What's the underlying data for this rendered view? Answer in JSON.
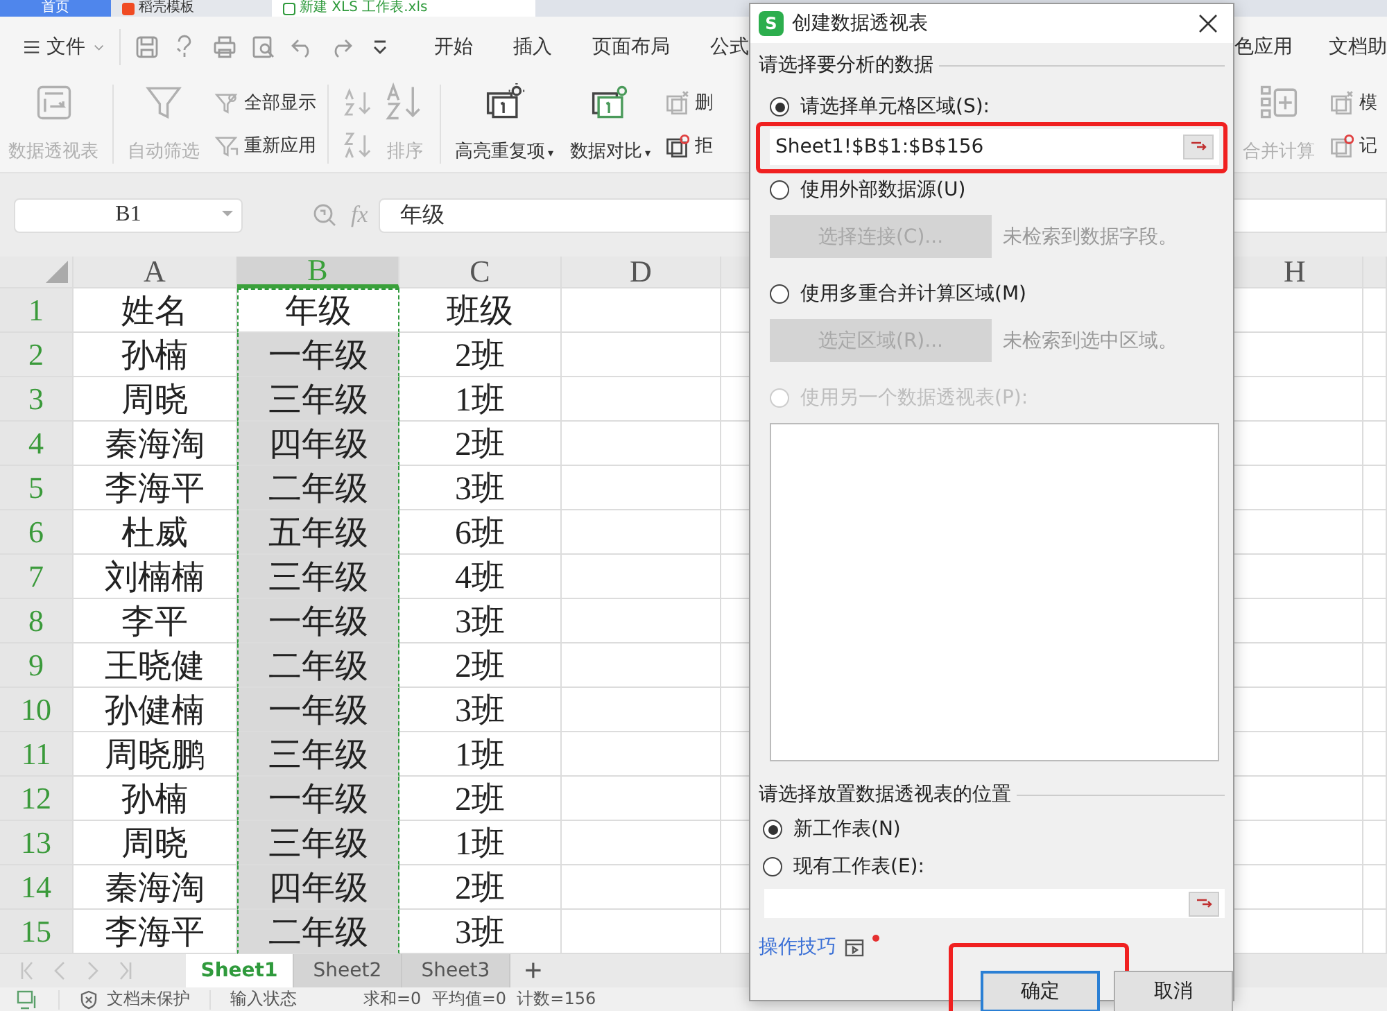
{
  "tabs": [
    {
      "kind": "home",
      "label": "首页",
      "selected": false
    },
    {
      "kind": "template",
      "label": "稻壳模板",
      "selected": false
    },
    {
      "kind": "doc",
      "label": "新建 XLS 工作表.xls",
      "selected": true
    }
  ],
  "menu": {
    "file": "文件",
    "tabs": [
      "开始",
      "插入",
      "页面布局",
      "公式"
    ],
    "tabs_right": [
      "色应用",
      "文档助"
    ]
  },
  "ribbon": [
    {
      "kind": "pivot",
      "label": "数据透视表",
      "disabled": true
    },
    {
      "kind": "filter",
      "label": "自动筛选",
      "disabled": true
    },
    {
      "kind": "filter-pair",
      "items": [
        {
          "label": "全部显示",
          "disabled": true
        },
        {
          "label": "重新应用",
          "disabled": true
        }
      ]
    },
    {
      "kind": "sort",
      "label": "排序",
      "disabled": true
    },
    {
      "kind": "highlight",
      "label": "高亮重复项",
      "disabled": false,
      "dropdown": "▾"
    },
    {
      "kind": "compare",
      "label": "数据对比",
      "disabled": false,
      "dropdown": "▾"
    },
    {
      "kind": "small-pair",
      "items": [
        {
          "label": "删",
          "disabled": true
        },
        {
          "label": "拒",
          "disabled": false
        }
      ]
    }
  ],
  "ribbon_right": [
    {
      "kind": "consolidate",
      "label": "合并计算",
      "disabled": true
    },
    {
      "kind": "small-pair",
      "items": [
        {
          "label": "模",
          "disabled": true
        },
        {
          "label": "记",
          "disabled": true
        }
      ]
    }
  ],
  "formula": {
    "name_box": "B1",
    "function_label": "fx",
    "value": "年级"
  },
  "sheet": {
    "columns": [
      {
        "label": "A",
        "selected": false
      },
      {
        "label": "B",
        "selected": true
      },
      {
        "label": "C",
        "selected": false
      },
      {
        "label": "D",
        "selected": false
      },
      {
        "label": "H",
        "selected": false
      }
    ],
    "rows": [
      {
        "number": "1",
        "selected": true,
        "cells": [
          "姓名",
          "年级",
          "班级"
        ]
      },
      {
        "number": "2",
        "selected": true,
        "cells": [
          "孙楠",
          "一年级",
          "2班"
        ]
      },
      {
        "number": "3",
        "selected": true,
        "cells": [
          "周晓",
          "三年级",
          "1班"
        ]
      },
      {
        "number": "4",
        "selected": true,
        "cells": [
          "秦海淘",
          "四年级",
          "2班"
        ]
      },
      {
        "number": "5",
        "selected": true,
        "cells": [
          "李海平",
          "二年级",
          "3班"
        ]
      },
      {
        "number": "6",
        "selected": true,
        "cells": [
          "杜威",
          "五年级",
          "6班"
        ]
      },
      {
        "number": "7",
        "selected": true,
        "cells": [
          "刘楠楠",
          "三年级",
          "4班"
        ]
      },
      {
        "number": "8",
        "selected": true,
        "cells": [
          "李平",
          "一年级",
          "3班"
        ]
      },
      {
        "number": "9",
        "selected": true,
        "cells": [
          "王晓健",
          "二年级",
          "2班"
        ]
      },
      {
        "number": "10",
        "selected": true,
        "cells": [
          "孙健楠",
          "一年级",
          "3班"
        ]
      },
      {
        "number": "11",
        "selected": true,
        "cells": [
          "周晓鹏",
          "三年级",
          "1班"
        ]
      },
      {
        "number": "12",
        "selected": true,
        "cells": [
          "孙楠",
          "一年级",
          "2班"
        ]
      },
      {
        "number": "13",
        "selected": true,
        "cells": [
          "周晓",
          "三年级",
          "1班"
        ]
      },
      {
        "number": "14",
        "selected": true,
        "cells": [
          "秦海淘",
          "四年级",
          "2班"
        ]
      },
      {
        "number": "15",
        "selected": true,
        "cells": [
          "李海平",
          "二年级",
          "3班"
        ]
      }
    ]
  },
  "sheet_tabs": {
    "tabs": [
      {
        "label": "Sheet1",
        "selected": true
      },
      {
        "label": "Sheet2",
        "selected": false
      },
      {
        "label": "Sheet3",
        "selected": false
      }
    ],
    "add": "+"
  },
  "status": {
    "protection": "文档未保护",
    "input_state": "输入状态",
    "summary": "求和=0  平均值=0  计数=156"
  },
  "dialog": {
    "app_icon_letter": "S",
    "title": "创建数据透视表",
    "source_heading": "请选择要分析的数据",
    "source_options": [
      {
        "kind": "range",
        "label": "请选择单元格区域(S):",
        "selected": true,
        "disabled": false,
        "value": "Sheet1!$B$1:$B$156",
        "highlighted": true
      },
      {
        "kind": "button",
        "label": "使用外部数据源(U)",
        "selected": false,
        "disabled": false,
        "button": "选择连接(C)...",
        "button_disabled": true,
        "note": "未检索到数据字段。"
      },
      {
        "kind": "button",
        "label": "使用多重合并计算区域(M)",
        "selected": false,
        "disabled": false,
        "button": "选定区域(R)...",
        "button_disabled": true,
        "note": "未检索到选中区域。"
      },
      {
        "kind": "list",
        "label": "使用另一个数据透视表(P):",
        "selected": false,
        "disabled": true
      }
    ],
    "target_heading": "请选择放置数据透视表的位置",
    "target_options": [
      {
        "label": "新工作表(N)",
        "selected": true
      },
      {
        "label": "现有工作表(E):",
        "selected": false
      }
    ],
    "tips_link": "操作技巧",
    "tips_new": true,
    "buttons": [
      {
        "label": "确定",
        "default": true,
        "highlighted": true
      },
      {
        "label": "取消",
        "default": false,
        "highlighted": false
      }
    ]
  }
}
